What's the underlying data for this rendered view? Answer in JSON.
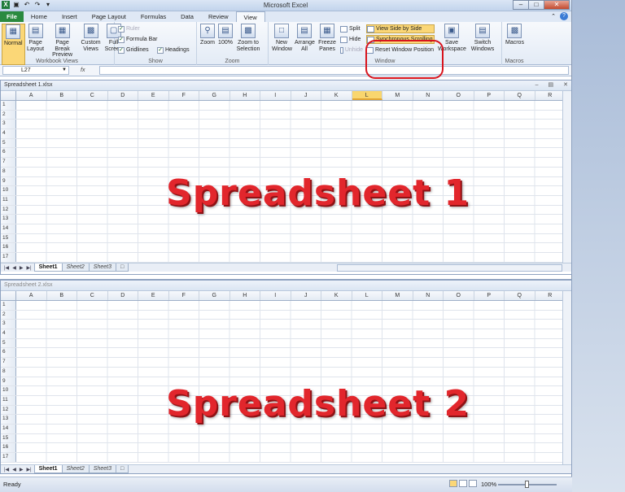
{
  "app": {
    "title": "Microsoft Excel"
  },
  "tabs": [
    "File",
    "Home",
    "Insert",
    "Page Layout",
    "Formulas",
    "Data",
    "Review",
    "View"
  ],
  "active_tab": "View",
  "ribbon": {
    "workbook_views": {
      "label": "Workbook Views",
      "buttons": [
        "Normal",
        "Page Layout",
        "Page Break Preview",
        "Custom Views",
        "Full Screen"
      ]
    },
    "show": {
      "label": "Show",
      "items": [
        {
          "label": "Ruler",
          "checked": true,
          "disabled": true
        },
        {
          "label": "Formula Bar",
          "checked": true
        },
        {
          "label": "Gridlines",
          "checked": true
        },
        {
          "label": "Headings",
          "checked": true
        }
      ]
    },
    "zoom": {
      "label": "Zoom",
      "buttons": [
        "Zoom",
        "100%",
        "Zoom to Selection"
      ]
    },
    "window": {
      "label": "Window",
      "big_buttons": [
        "New Window",
        "Arrange All",
        "Freeze Panes"
      ],
      "small_buttons": [
        "Split",
        "Hide",
        "Unhide"
      ],
      "side_buttons": [
        "View Side by Side",
        "Synchronous Scrolling",
        "Reset Window Position"
      ],
      "more": [
        "Save Workspace",
        "Switch Windows"
      ]
    },
    "macros": {
      "label": "Macros",
      "buttons": [
        "Macros"
      ]
    }
  },
  "formula_bar": {
    "name_box": "L27",
    "fx": "fx",
    "value": ""
  },
  "workbook1": {
    "title": "Spreadsheet 1.xlsx",
    "overlay": "Spreadsheet 1",
    "selected_column": "L"
  },
  "workbook2": {
    "title": "Spreadsheet 2.xlsx",
    "overlay": "Spreadsheet 2"
  },
  "columns": [
    "A",
    "B",
    "C",
    "D",
    "E",
    "F",
    "G",
    "H",
    "I",
    "J",
    "K",
    "L",
    "M",
    "N",
    "O",
    "P",
    "Q",
    "R"
  ],
  "rows": [
    "1",
    "2",
    "3",
    "4",
    "5",
    "6",
    "7",
    "8",
    "9",
    "10",
    "11",
    "12",
    "13",
    "14",
    "15",
    "16",
    "17"
  ],
  "sheets": [
    "Sheet1",
    "Sheet2",
    "Sheet3"
  ],
  "status": {
    "ready": "Ready",
    "zoom": "100%"
  }
}
